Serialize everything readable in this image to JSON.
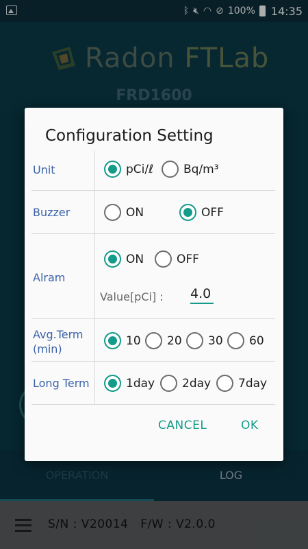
{
  "status_bar": {
    "time": "14:35",
    "battery": "100%",
    "icons": [
      "image-icon",
      "bluetooth-icon",
      "mute-icon",
      "wifi-icon",
      "do-not-disturb-icon",
      "battery-charging-icon"
    ]
  },
  "app": {
    "logo_word_a": "Radon",
    "logo_word_b": "FTLab",
    "model": "FRD1600"
  },
  "tabs": {
    "operation": "OPERATION",
    "log": "LOG"
  },
  "footer": {
    "serial": "S/N : V20014",
    "firmware": "F/W : V2.0.0"
  },
  "dialog": {
    "title": "Configuration Setting",
    "unit": {
      "label": "Unit",
      "options": [
        "pCi/ℓ",
        "Bq/m³"
      ],
      "selected": "pCi/ℓ"
    },
    "buzzer": {
      "label": "Buzzer",
      "options": [
        "ON",
        "OFF"
      ],
      "selected": "OFF"
    },
    "alarm": {
      "label": "Alram",
      "options": [
        "ON",
        "OFF"
      ],
      "selected": "ON",
      "value_label": "Value[pCi] :",
      "value": "4.0"
    },
    "avg_term": {
      "label_line1": "Avg.Term",
      "label_line2": "(min)",
      "options": [
        "10",
        "20",
        "30",
        "60"
      ],
      "selected": "10"
    },
    "long_term": {
      "label": "Long Term",
      "options": [
        "1day",
        "2day",
        "7day"
      ],
      "selected": "1day"
    },
    "cancel_label": "CANCEL",
    "ok_label": "OK"
  },
  "colors": {
    "accent": "#149b8a",
    "label_blue": "#3b63a8",
    "app_background": "#0b3a49"
  }
}
